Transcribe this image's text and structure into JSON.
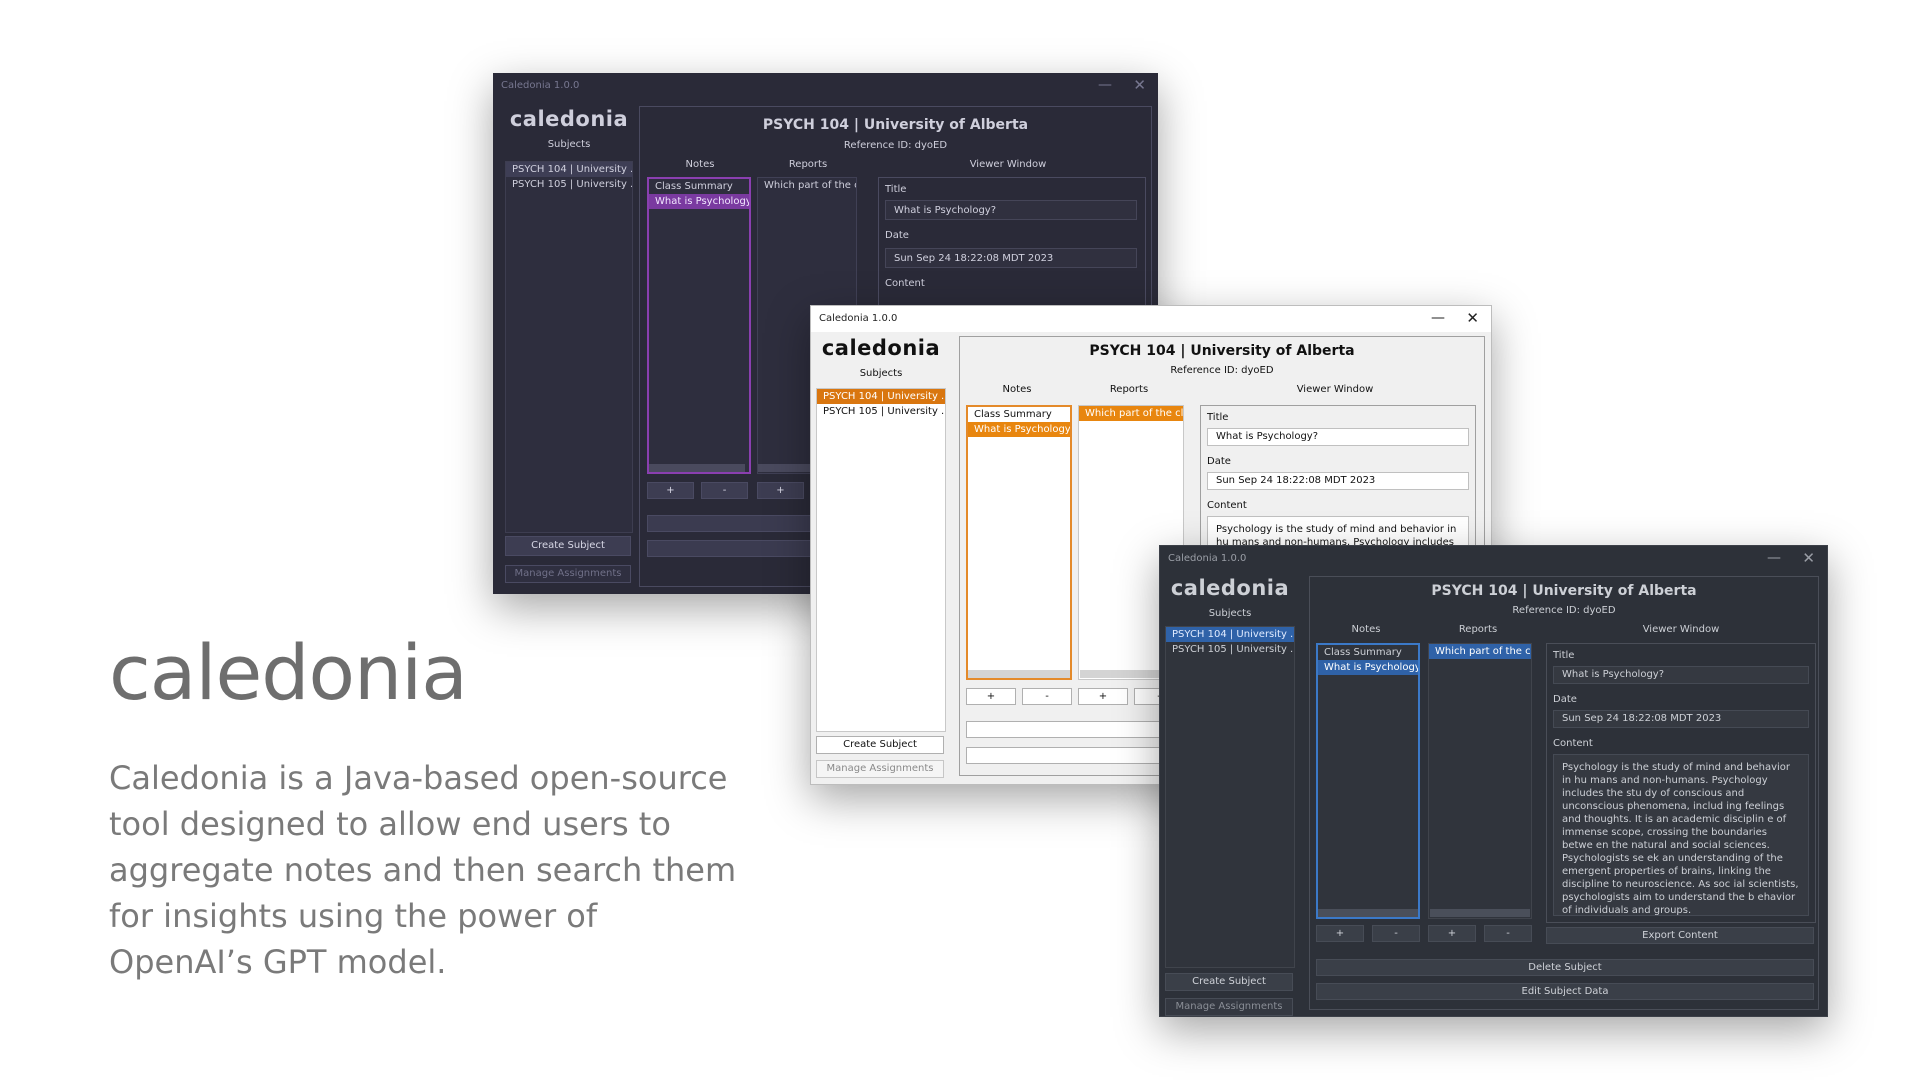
{
  "brand": {
    "title": "caledonia",
    "description": "Caledonia is a Java-based open-source tool designed to allow end users to aggregate notes and then search them for insights using the power of OpenAI’s GPT model."
  },
  "colors": {
    "purple_accent": "#8a3fb0",
    "orange_accent": "#e8860f",
    "blue_accent": "#2f62a8"
  },
  "icons": {
    "minimize": "minimize-icon",
    "close": "close-icon"
  },
  "app": {
    "window_title": "Caledonia 1.0.0",
    "logo": "caledonia",
    "subjects_label": "Subjects",
    "subjects": [
      "PSYCH 104 | University ...",
      "PSYCH 105 | University ..."
    ],
    "create_subject": "Create Subject",
    "manage_assignments": "Manage Assignments",
    "main_title": "PSYCH 104 | University of Alberta",
    "reference": "Reference ID: dyoED",
    "notes_label": "Notes",
    "reports_label": "Reports",
    "viewer_label": "Viewer Window",
    "notes": [
      "Class Summary",
      "What is Psychology?"
    ],
    "reports": [
      "Which part of the cl..."
    ],
    "plus": "+",
    "minus": "-",
    "title_label": "Title",
    "title_value": "What is Psychology?",
    "date_label": "Date",
    "date_value": "Sun Sep 24 18:22:08 MDT 2023",
    "content_label": "Content",
    "content_value": "Psychology is the study of mind and behavior in hu mans and non-humans. Psychology includes the stu dy of conscious and unconscious phenomena, includ ing feelings and thoughts. It is an academic disciplin e of immense scope, crossing the boundaries betwe en the natural and social sciences. Psychologists se ek an understanding of the emergent properties of brains, linking the discipline to neuroscience. As soc ial scientists, psychologists aim to understand the b ehavior of individuals and groups.",
    "export_content": "Export Content",
    "delete_subject": "Delete Subject",
    "edit_subject_data": "Edit Subject Data"
  }
}
